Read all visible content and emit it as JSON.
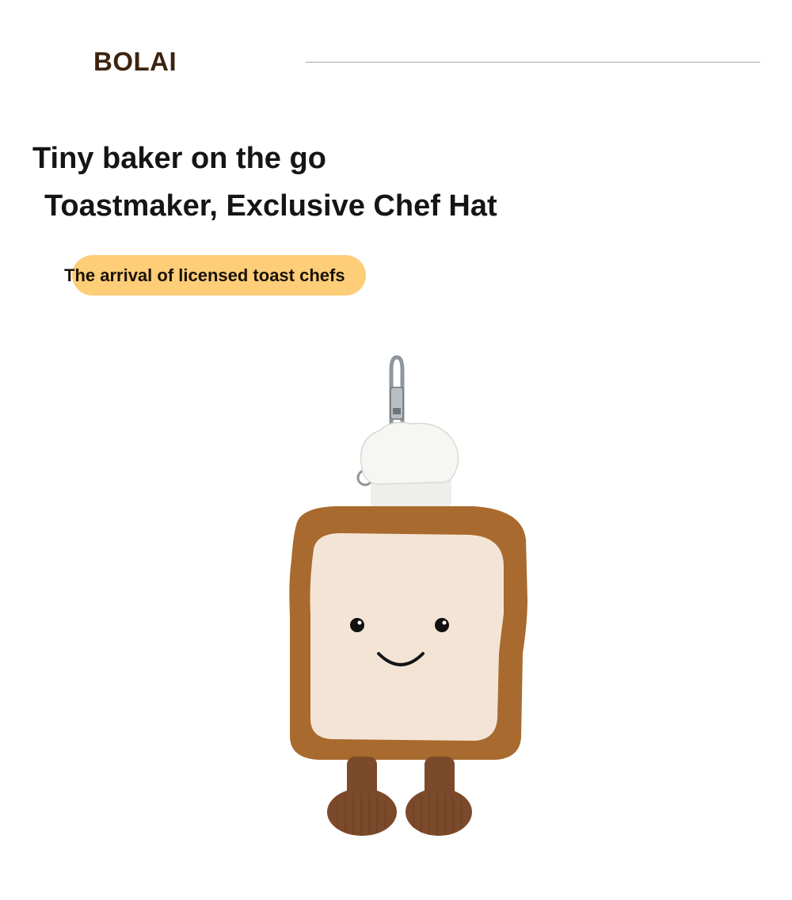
{
  "brand": "BOLAI",
  "headline": {
    "line1": "Tiny baker on the go",
    "line2": "Toastmaker, Exclusive Chef Hat"
  },
  "tag": "The arrival of licensed toast chefs",
  "product_image": {
    "icon": "toast-plush-keychain-icon",
    "colors": {
      "crust": "#a86a2e",
      "bread": "#f4e4d6",
      "hat": "#f3f3f0",
      "legs": "#7b4a2a",
      "clip": "#8f969c"
    }
  }
}
